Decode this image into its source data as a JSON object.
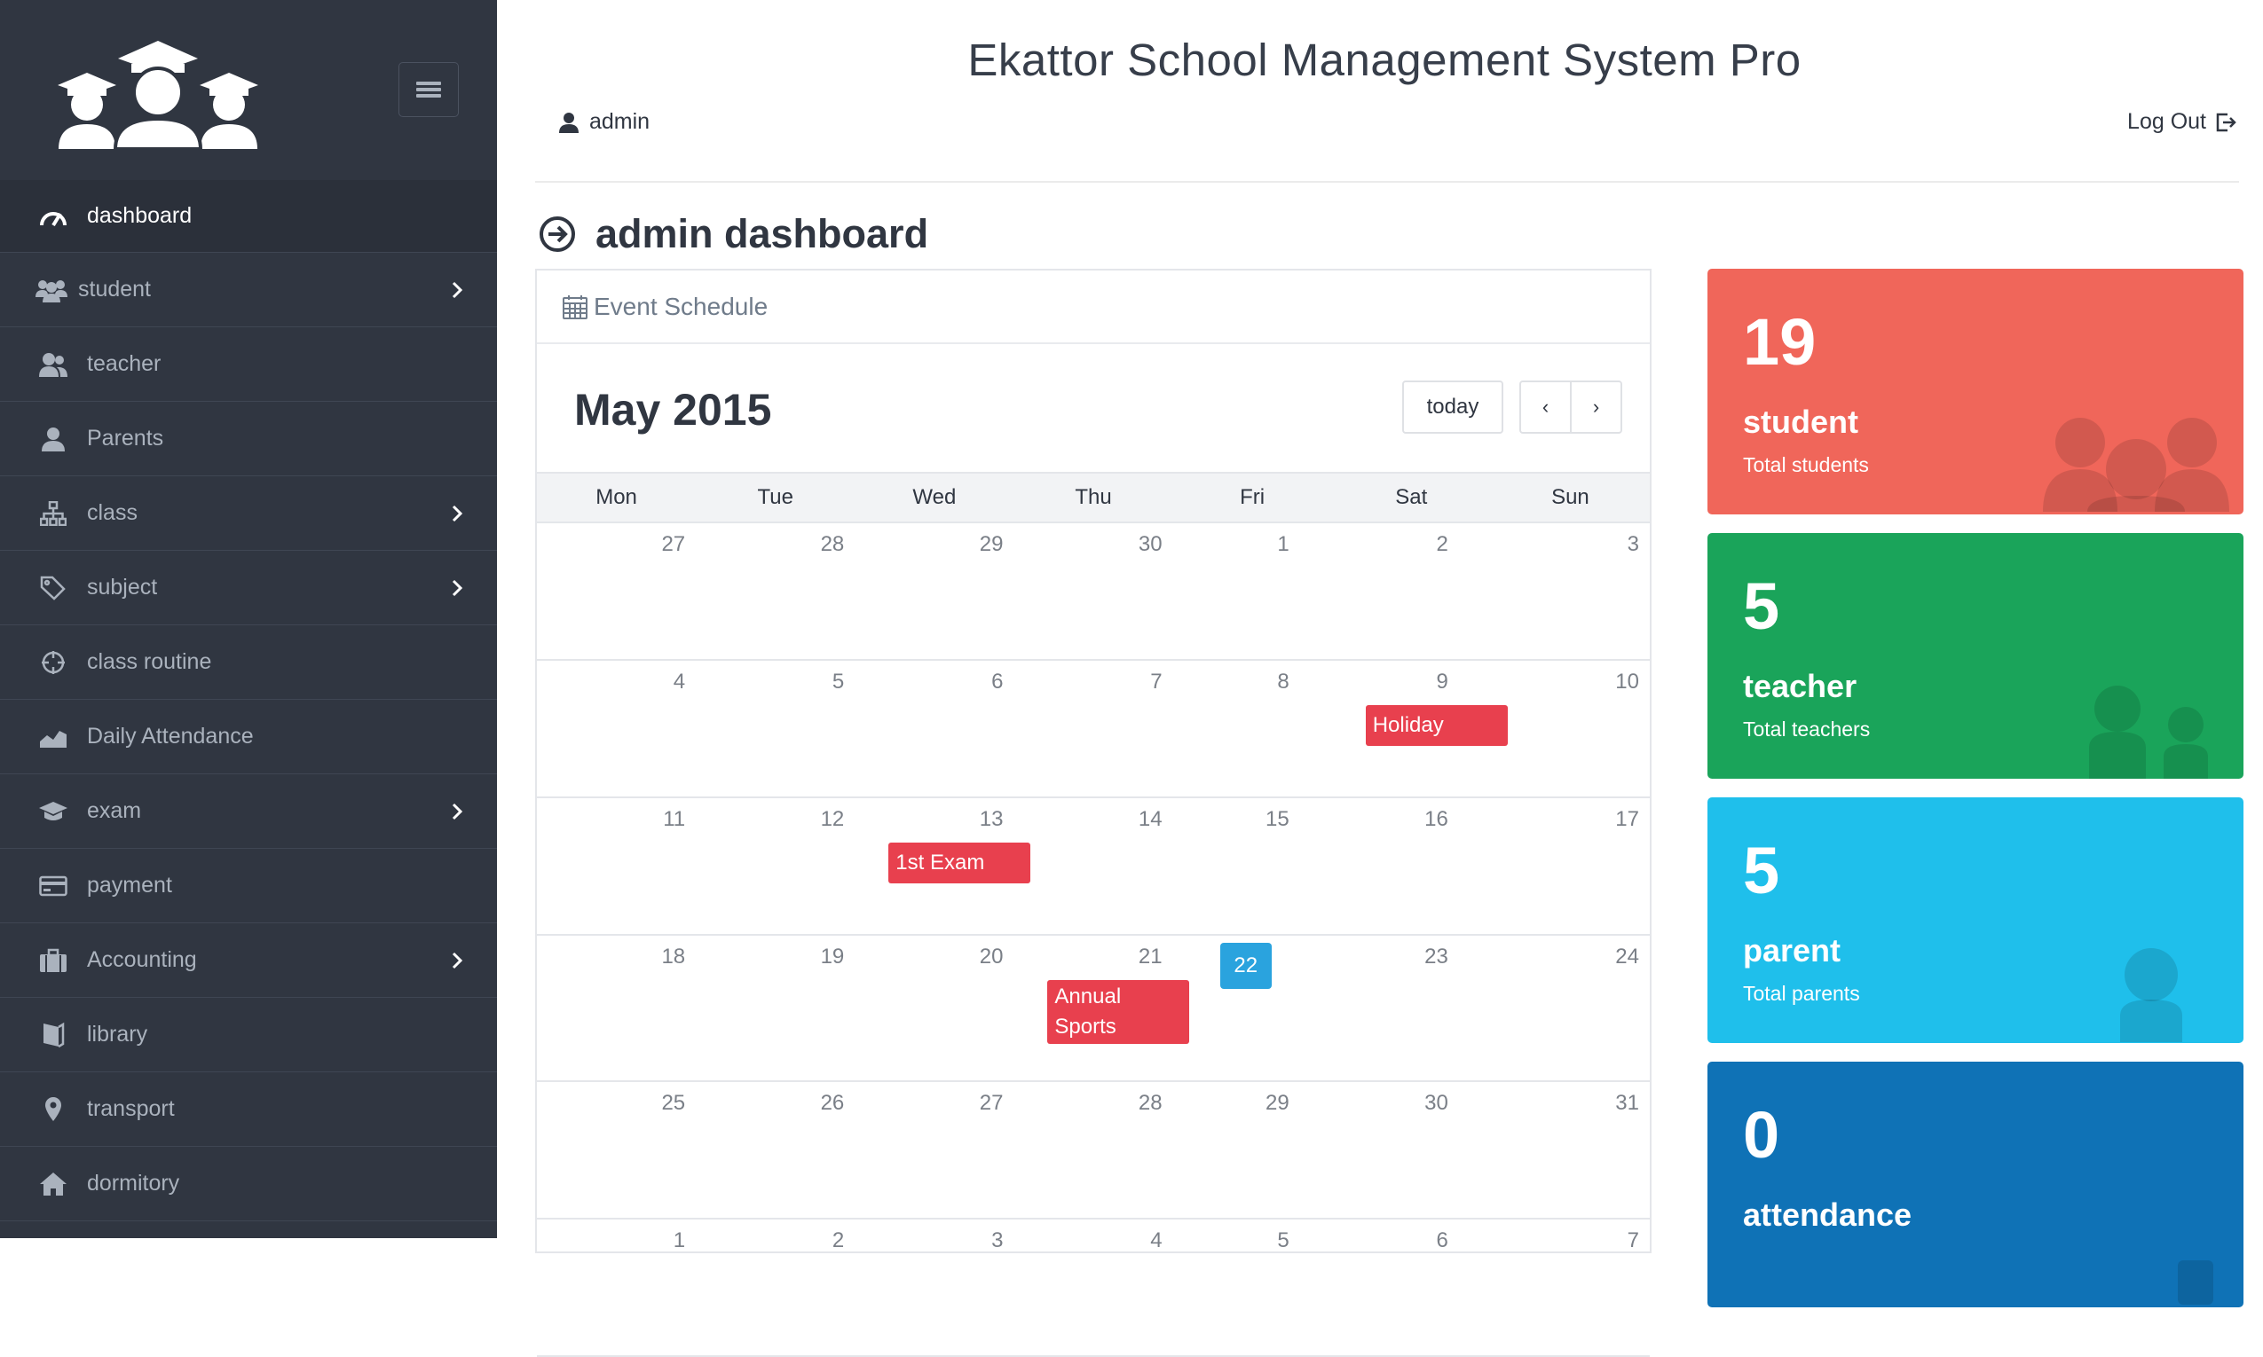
{
  "header": {
    "title": "Ekattor School Management System Pro",
    "user": "admin",
    "logout": "Log Out"
  },
  "sidebar": {
    "items": [
      {
        "label": "dashboard",
        "icon": "gauge-icon",
        "has_submenu": false,
        "active": true
      },
      {
        "label": "student",
        "icon": "users-icon",
        "has_submenu": true
      },
      {
        "label": "teacher",
        "icon": "user-group-icon",
        "has_submenu": false
      },
      {
        "label": "Parents",
        "icon": "user-icon",
        "has_submenu": false
      },
      {
        "label": "class",
        "icon": "sitemap-icon",
        "has_submenu": true
      },
      {
        "label": "subject",
        "icon": "tags-icon",
        "has_submenu": true
      },
      {
        "label": "class routine",
        "icon": "crosshair-icon",
        "has_submenu": false
      },
      {
        "label": "Daily Attendance",
        "icon": "area-chart-icon",
        "has_submenu": false
      },
      {
        "label": "exam",
        "icon": "graduation-cap-icon",
        "has_submenu": true
      },
      {
        "label": "payment",
        "icon": "credit-card-icon",
        "has_submenu": false
      },
      {
        "label": "Accounting",
        "icon": "briefcase-icon",
        "has_submenu": true
      },
      {
        "label": "library",
        "icon": "book-icon",
        "has_submenu": false
      },
      {
        "label": "transport",
        "icon": "map-pin-icon",
        "has_submenu": false
      },
      {
        "label": "dormitory",
        "icon": "home-icon",
        "has_submenu": false
      }
    ]
  },
  "main": {
    "page_title": "admin dashboard",
    "calendar": {
      "panel_title": "Event Schedule",
      "month": "May 2015",
      "today_label": "today",
      "prev_label": "‹",
      "next_label": "›",
      "weekdays": [
        "Mon",
        "Tue",
        "Wed",
        "Thu",
        "Fri",
        "Sat",
        "Sun"
      ],
      "weeks": [
        [
          "27",
          "28",
          "29",
          "30",
          "1",
          "2",
          "3"
        ],
        [
          "4",
          "5",
          "6",
          "7",
          "8",
          "9",
          "10"
        ],
        [
          "11",
          "12",
          "13",
          "14",
          "15",
          "16",
          "17"
        ],
        [
          "18",
          "19",
          "20",
          "21",
          "22",
          "23",
          "24"
        ],
        [
          "25",
          "26",
          "27",
          "28",
          "29",
          "30",
          "31"
        ],
        [
          "1",
          "2",
          "3",
          "4",
          "5",
          "6",
          "7"
        ]
      ],
      "today_day": "22",
      "events": [
        {
          "title": "Holiday",
          "day": "9"
        },
        {
          "title": "1st Exam",
          "day": "13"
        },
        {
          "title": "Annual Sports",
          "day": "21"
        }
      ]
    },
    "stats": [
      {
        "count": "19",
        "label": "student",
        "sub": "Total students",
        "color": "#f0665a",
        "icon": "users-icon"
      },
      {
        "count": "5",
        "label": "teacher",
        "sub": "Total teachers",
        "color": "#1aa45a",
        "icon": "user-group-icon"
      },
      {
        "count": "5",
        "label": "parent",
        "sub": "Total parents",
        "color": "#1fbfeb",
        "icon": "user-icon"
      },
      {
        "count": "0",
        "label": "attendance",
        "sub": "",
        "color": "#0f72b6",
        "icon": "bar-chart-icon"
      }
    ]
  }
}
